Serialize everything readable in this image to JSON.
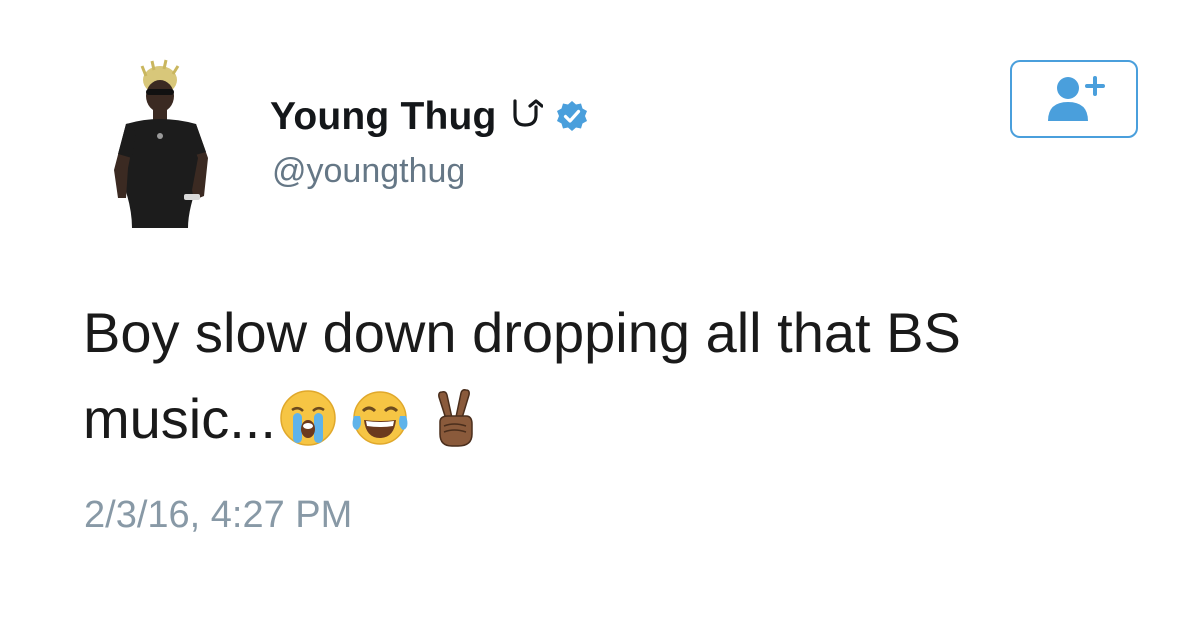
{
  "tweet": {
    "author": {
      "display_name": "Young Thug",
      "name_symbol": "Ɔ̲",
      "name_symbol_glyph": "Ʋ",
      "handle": "@youngthug",
      "verified": true,
      "avatar_icon": "profile-photo"
    },
    "follow_button": {
      "icon": "add-user-icon",
      "accent_color": "#4a9fdc"
    },
    "text_line_1": "Boy slow down dropping all that BS",
    "text_line_2": "music...",
    "emojis": [
      "loudly-crying-face-emoji",
      "face-with-tears-of-joy-emoji",
      "victory-hand-emoji"
    ],
    "timestamp": "2/3/16, 4:27 PM"
  }
}
